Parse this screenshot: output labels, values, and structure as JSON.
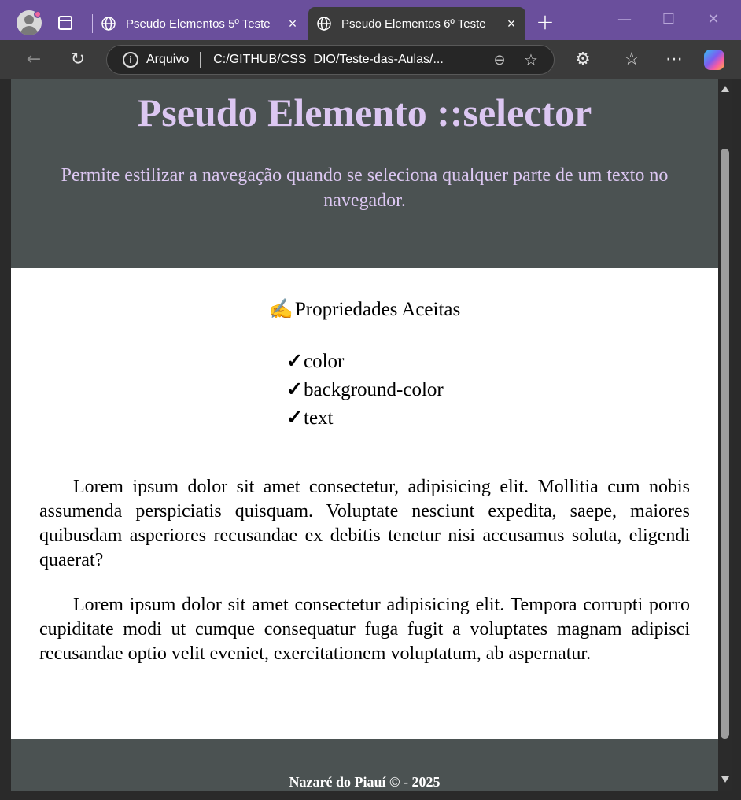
{
  "browser": {
    "tabs": [
      {
        "label": "Pseudo Elementos 5º Teste",
        "active": false
      },
      {
        "label": "Pseudo Elementos 6º Teste",
        "active": true
      }
    ],
    "address": {
      "label": "Arquivo",
      "url": "C:/GITHUB/CSS_DIO/Teste-das-Aulas/..."
    },
    "icons": {
      "close": "×",
      "new_tab": "+",
      "minimize": "—",
      "maximize": "☐",
      "window_close": "✕",
      "back": "←",
      "reload": "↻",
      "info": "i",
      "zoom": "⊖",
      "favorite": "☆",
      "extensions": "⚙",
      "favorites": "☆",
      "more": "⋯"
    }
  },
  "page": {
    "header": {
      "title": "Pseudo Elemento ::selector",
      "description": "Permite estilizar a navegação quando se seleciona qualquer parte de um texto no navegador."
    },
    "properties": {
      "emoji": "✍️",
      "title": "Propriedades Aceitas",
      "check": "✓",
      "items": [
        "color",
        "background-color",
        "text"
      ]
    },
    "paragraphs": [
      "Lorem ipsum dolor sit amet consectetur, adipisicing elit. Mollitia cum nobis assumenda perspiciatis quisquam. Voluptate nesciunt expedita, saepe, maiores quibusdam asperiores recusandae ex debitis tenetur nisi accusamus soluta, eligendi quaerat?",
      "Lorem ipsum dolor sit amet consectetur adipisicing elit. Tempora corrupti porro cupiditate modi ut cumque consequatur fuga fugit a voluptates magnam adipisci recusandae optio velit eveniet, exercitationem voluptatum, ab aspernatur."
    ],
    "footer": "Nazaré do Piauí © - 2025"
  },
  "colors": {
    "titlebar": "#6a4f9c",
    "header_bg": "#4b5252",
    "header_text": "#dcc7f2"
  }
}
